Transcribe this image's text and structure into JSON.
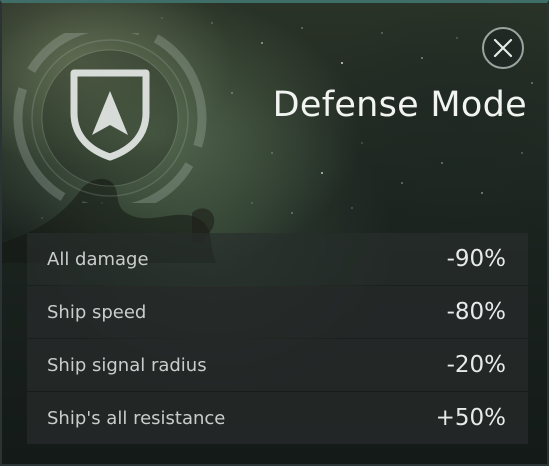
{
  "dialog": {
    "title": "Defense Mode",
    "emblem_icon": "shield-arrow-icon",
    "close_icon": "close-icon"
  },
  "stats": [
    {
      "label": "All damage",
      "value": "-90%"
    },
    {
      "label": "Ship speed",
      "value": "-80%"
    },
    {
      "label": "Ship signal radius",
      "value": "-20%"
    },
    {
      "label": "Ship's all resistance",
      "value": "+50%"
    }
  ],
  "colors": {
    "accent_border": "#3f6e68",
    "text": "#f2f4f2",
    "row_bg": "#262a2a"
  }
}
